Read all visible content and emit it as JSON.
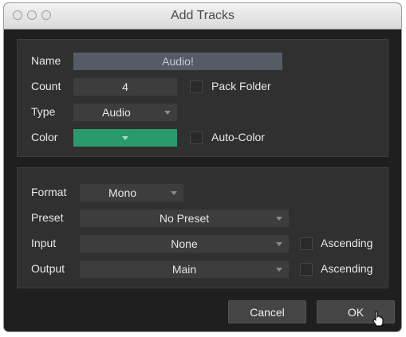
{
  "window": {
    "title": "Add Tracks"
  },
  "track": {
    "name_label": "Name",
    "name_value": "Audio!",
    "count_label": "Count",
    "count_value": "4",
    "pack_folder_label": "Pack Folder",
    "type_label": "Type",
    "type_value": "Audio",
    "color_label": "Color",
    "color_value": "#2a9a6c",
    "auto_color_label": "Auto-Color"
  },
  "io": {
    "format_label": "Format",
    "format_value": "Mono",
    "preset_label": "Preset",
    "preset_value": "No Preset",
    "input_label": "Input",
    "input_value": "None",
    "output_label": "Output",
    "output_value": "Main",
    "ascending_label": "Ascending"
  },
  "buttons": {
    "cancel": "Cancel",
    "ok": "OK"
  }
}
